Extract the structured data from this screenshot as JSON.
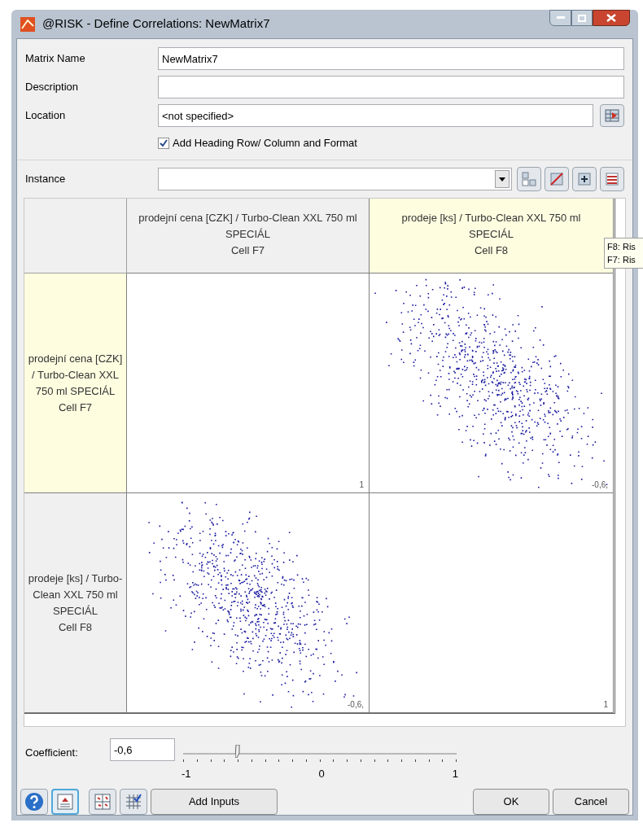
{
  "window": {
    "title": "@RISK - Define Correlations: NewMatrix7"
  },
  "fields": [
    {
      "label": "Matrix Name",
      "value": "NewMatrix7",
      "has_button": false
    },
    {
      "label": "Description",
      "has_button": false
    },
    {
      "label": "Location",
      "value": "<not specified>",
      "has_button": true
    }
  ],
  "heading_checkbox": {
    "label": "Add Heading Row/ Column and Format",
    "checked": true
  },
  "instance": {
    "label": "Instance"
  },
  "matrix": {
    "columns": [
      {
        "label": "prodejní cena [CZK] / Turbo-Clean XXL 750 ml SPECIÁL",
        "cell": "Cell F7",
        "highlighted": false
      },
      {
        "label": "prodeje [ks] / Turbo-Clean XXL 750 ml SPECIÁL",
        "cell": "Cell F8",
        "highlighted": true
      }
    ],
    "rows": [
      {
        "label": "prodejní cena [CZK] / Turbo-Clean XXL 750 ml SPECIÁL",
        "cell": "Cell F7",
        "highlighted": true,
        "cells": [
          {
            "kind": "diagonal",
            "corner": "1"
          },
          {
            "kind": "scatter",
            "corner": "-0,6,"
          }
        ]
      },
      {
        "label": "prodeje [ks] / Turbo-Clean XXL 750 ml SPECIÁL",
        "cell": "Cell F8",
        "highlighted": false,
        "cells": [
          {
            "kind": "scatter",
            "corner": "-0,6,"
          },
          {
            "kind": "diagonal",
            "corner": "1"
          }
        ]
      }
    ],
    "tooltip": [
      "F8: Ris",
      "F7: Ris"
    ]
  },
  "coefficient": {
    "label": "Coefficient:",
    "value": "-0,6",
    "level": 0.2,
    "ticks": [
      "-1",
      "0",
      "1"
    ]
  },
  "buttons": {
    "add_inputs": "Add Inputs",
    "ok": "OK",
    "cancel": "Cancel"
  }
}
